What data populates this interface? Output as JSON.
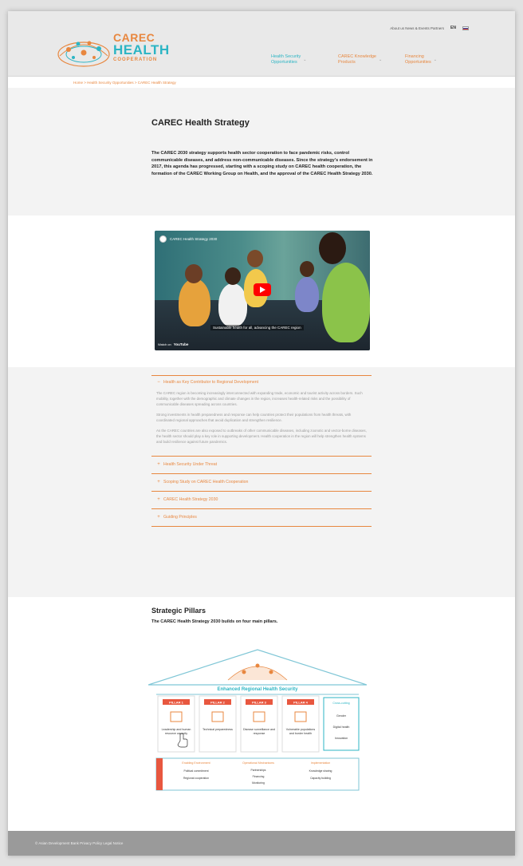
{
  "header": {
    "logo": {
      "line1": "CAREC",
      "line2": "HEALTH",
      "line3": "COOPERATION"
    },
    "topbar": {
      "links": "About us   News & Events   Partners",
      "lang": "EN"
    },
    "nav": [
      {
        "label": "Health Security\nOpportunities",
        "color": "teal"
      },
      {
        "label": "CAREC Knowledge\nProducts",
        "color": "orange"
      },
      {
        "label": "Financing\nOpportunities",
        "color": "orange"
      }
    ],
    "breadcrumb": "Home  >  Health Security Opportunities  >  CAREC Health Strategy"
  },
  "intro": {
    "title": "CAREC Health Strategy",
    "lead": "The CAREC 2030 strategy supports health sector cooperation to face pandemic risks, control communicable diseases, and address non-communicable diseases. Since the strategy's endorsement in 2017, this agenda has progressed, starting with a scoping study on CAREC health cooperation, the formation of the CAREC Working Group on Health, and the approval of the CAREC Health Strategy 2030."
  },
  "video": {
    "title": "CAREC Health Strategy 2030",
    "caption": "Sustainable health for all, advancing the CAREC region",
    "watch_on": "Watch on",
    "platform": "YouTube"
  },
  "accordion": {
    "open_item": {
      "label": "Health as Key Contributor to Regional Development",
      "paragraphs": [
        "The CAREC region is becoming increasingly interconnected with expanding trade, economic and tourist activity across borders. Such mobility, together with the demographic and climate changes in the region, increases health-related risks and the possibility of communicable diseases spreading across countries.",
        "Strong investments in health preparedness and response can help countries protect their populations from health threats, with coordinated regional approaches that avoid duplication and strengthen resilience.",
        "As the CAREC countries are also exposed to outbreaks of other communicable diseases, including zoonotic and vector-borne diseases, the health sector should play a key role in supporting development. Health cooperation in the region will help strengthen health systems and build resilience against future pandemics."
      ]
    },
    "closed_items": [
      "Health Security Under Threat",
      "Scoping Study on CAREC Health Cooperation",
      "CAREC Health Strategy 2030",
      "Guiding Principles"
    ]
  },
  "pillars": {
    "title": "Strategic Pillars",
    "subtitle": "The CAREC Health Strategy 2030 builds on four main pillars.",
    "diagram": {
      "roof_label": "Enhanced Regional Health Security",
      "pillars": [
        {
          "tag": "PILLAR 1",
          "text": "Leadership and human resource capacity"
        },
        {
          "tag": "PILLAR 2",
          "text": "Technical preparedness"
        },
        {
          "tag": "PILLAR 3",
          "text": "Disease surveillance and response"
        },
        {
          "tag": "PILLAR 4",
          "text": "Vulnerable populations and border health"
        }
      ],
      "side_box": {
        "title": "Cross-cutting",
        "items": [
          "Gender",
          "Digital health",
          "Innovation"
        ]
      },
      "base_sections": [
        {
          "title": "Enabling Environment",
          "items": [
            "Political commitment",
            "Regional cooperation"
          ]
        },
        {
          "title": "Operational Mechanisms",
          "items": [
            "Partnerships",
            "Financing",
            "Monitoring"
          ]
        },
        {
          "title": "Implementation",
          "items": [
            "Knowledge sharing",
            "Capacity building"
          ]
        }
      ]
    }
  },
  "footer": {
    "text": "© Asian Development Bank   Privacy Policy   Legal Notice"
  },
  "colors": {
    "accent_orange": "#e8873f",
    "accent_teal": "#2cb5c4",
    "footer_gray": "#9a9a9a"
  }
}
